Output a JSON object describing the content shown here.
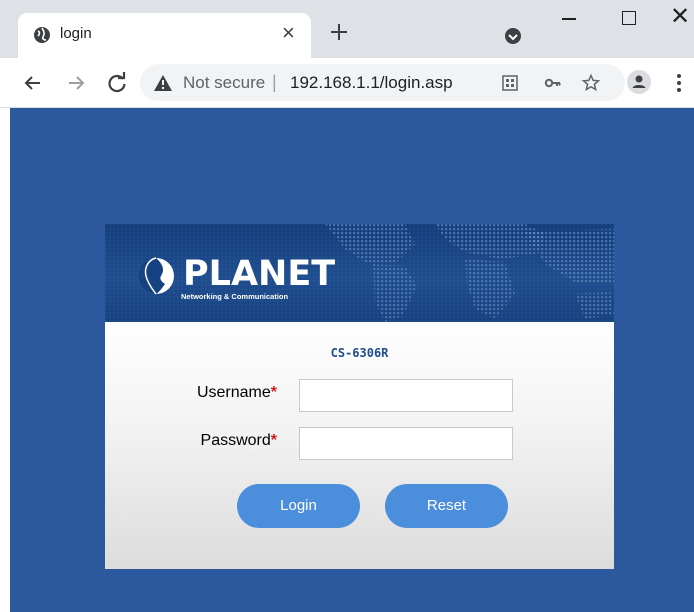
{
  "browser": {
    "tab": {
      "title": "login",
      "favicon": "globe-icon",
      "close_glyph": "×"
    },
    "new_tab_icon": "plus-icon",
    "window_controls": [
      "minimize-icon",
      "maximize-icon",
      "close-icon"
    ],
    "close_glyph": "✕",
    "toolbar": {
      "back_icon": "arrow-left-icon",
      "forward_icon": "arrow-right-icon",
      "reload_icon": "reload-icon",
      "security_label": "Not secure",
      "separator": "|",
      "url": "192.168.1.1/login.asp",
      "icons": [
        "qr-code-icon",
        "key-icon",
        "star-icon",
        "profile-icon",
        "kebab-menu-icon"
      ]
    },
    "colors": {
      "tabstrip": "#dee1e6",
      "omnibox": "#f1f3f4"
    }
  },
  "page": {
    "background_color": "#2c599d",
    "login": {
      "brand_name": "PLANET",
      "brand_tagline": "Networking & Communication",
      "model": "CS-6306R",
      "username_label": "Username",
      "password_label": "Password",
      "required_mark": "*",
      "username_value": "",
      "password_value": "",
      "login_button": "Login",
      "reset_button": "Reset",
      "colors": {
        "header": "#1a4788",
        "button": "#4a8edc",
        "required": "#d81b1b",
        "model_text": "#1f4c8c"
      }
    }
  }
}
